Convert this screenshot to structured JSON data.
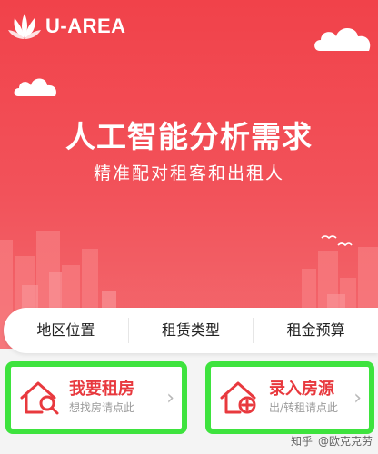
{
  "header": {
    "brand": "U-AREA"
  },
  "hero": {
    "headline": "人工智能分析需求",
    "subline": "精准配对租客和出租人"
  },
  "filters": [
    {
      "label": "地区位置"
    },
    {
      "label": "租赁类型"
    },
    {
      "label": "租金预算"
    }
  ],
  "cards": {
    "rent": {
      "title": "我要租房",
      "subtitle": "想找房请点此"
    },
    "list": {
      "title": "录入房源",
      "subtitle": "出/转租请点此"
    }
  },
  "watermark": {
    "site": "知乎",
    "author": "@欧克克劳"
  },
  "colors": {
    "primary": "#f2474f",
    "highlight": "#3ee33e",
    "title": "#e8393e"
  },
  "icons": {
    "rent": "house-search-icon",
    "list": "house-plus-icon",
    "chevron": "chevron-right-icon"
  }
}
